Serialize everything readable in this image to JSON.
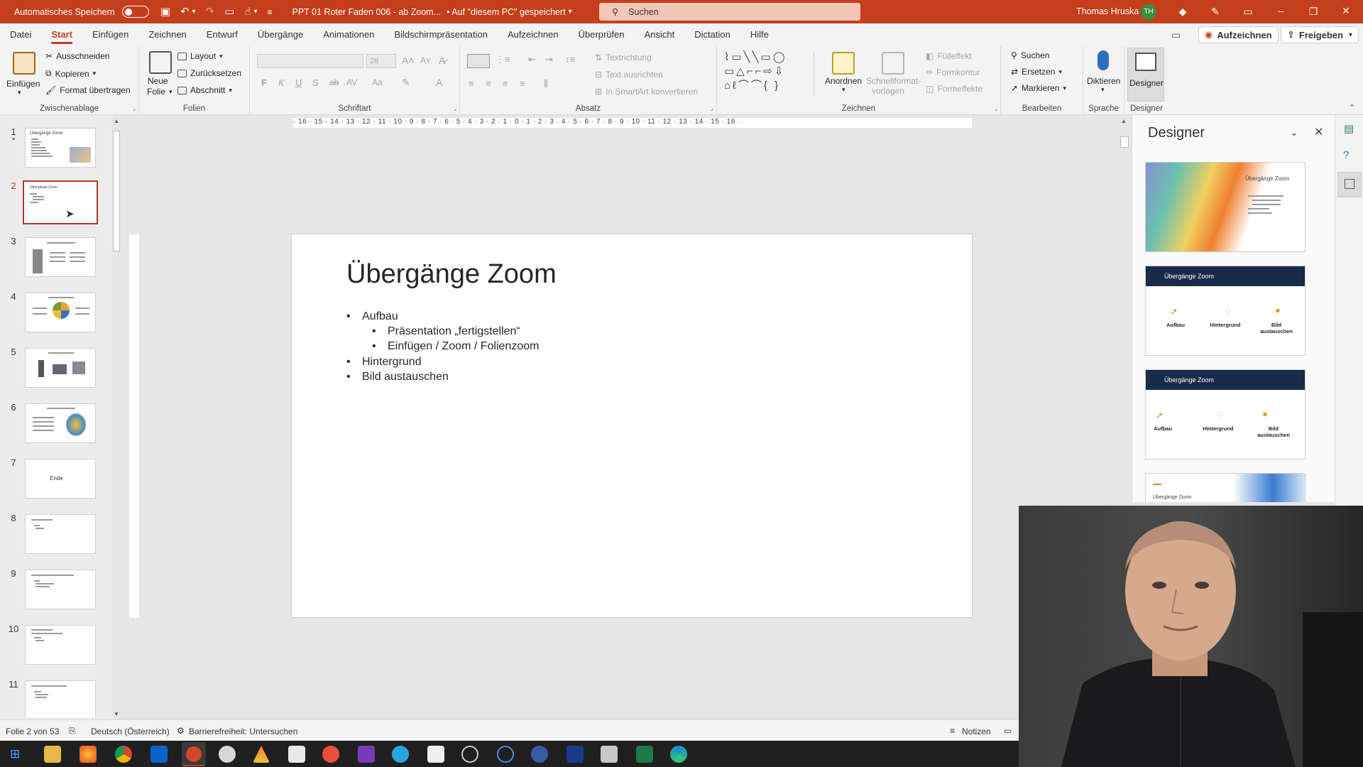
{
  "titlebar": {
    "autosave_label": "Automatisches Speichern",
    "doc_title": "PPT 01 Roter Faden 006 - ab Zoom...",
    "save_location": "• Auf \"diesem PC\" gespeichert",
    "search_placeholder": "Suchen",
    "user_name": "Thomas Hruska",
    "user_initials": "TH",
    "accent_color": "#c43e1c"
  },
  "menu": {
    "tabs": [
      "Datei",
      "Start",
      "Einfügen",
      "Zeichnen",
      "Entwurf",
      "Übergänge",
      "Animationen",
      "Bildschirmpräsentation",
      "Aufzeichnen",
      "Überprüfen",
      "Ansicht",
      "Dictation",
      "Hilfe"
    ],
    "active_tab": "Start",
    "record_button": "Aufzeichnen",
    "share_button": "Freigeben"
  },
  "ribbon": {
    "clipboard": {
      "label": "Zwischenablage",
      "paste": "Einfügen",
      "cut": "Ausschneiden",
      "copy": "Kopieren",
      "format_painter": "Format übertragen"
    },
    "slides": {
      "label": "Folien",
      "new_slide_1": "Neue",
      "new_slide_2": "Folie",
      "layout": "Layout",
      "reset": "Zurücksetzen",
      "section": "Abschnitt"
    },
    "font": {
      "label": "Schriftart",
      "size": "28",
      "bold": "F",
      "italic": "K",
      "underline": "U",
      "strike": "S",
      "spacing": "AV",
      "case": "Aa"
    },
    "paragraph": {
      "label": "Absatz",
      "text_direction": "Textrichtung",
      "align_text": "Text ausrichten",
      "smartart": "In SmartArt konvertieren"
    },
    "drawing": {
      "label": "Zeichnen",
      "arrange": "Anordnen",
      "quick_styles_1": "Schnellformat-",
      "quick_styles_2": "vorlagen",
      "fill": "Fülleffekt",
      "outline": "Formkontur",
      "effects": "Formeffekte"
    },
    "editing": {
      "label": "Bearbeiten",
      "find": "Suchen",
      "replace": "Ersetzen",
      "select": "Markieren"
    },
    "voice": {
      "label": "Sprache",
      "dictate": "Diktieren"
    },
    "designer_group": {
      "label": "Designer",
      "button": "Designer"
    }
  },
  "thumbnails": [
    {
      "num": "1",
      "title": "Übergänge Zoom"
    },
    {
      "num": "2",
      "title": "Übergänge Zoom"
    },
    {
      "num": "3",
      "title": ""
    },
    {
      "num": "4",
      "title": ""
    },
    {
      "num": "5",
      "title": ""
    },
    {
      "num": "6",
      "title": ""
    },
    {
      "num": "7",
      "title": "Ende"
    },
    {
      "num": "8",
      "title": ""
    },
    {
      "num": "9",
      "title": ""
    },
    {
      "num": "10",
      "title": ""
    },
    {
      "num": "11",
      "title": ""
    }
  ],
  "slide": {
    "title": "Übergänge Zoom",
    "bullets": [
      {
        "text": "Aufbau",
        "level": 1
      },
      {
        "text": "Präsentation „fertigstellen“",
        "level": 2
      },
      {
        "text": "Einfügen / Zoom / Folienzoom",
        "level": 2
      },
      {
        "text": "Hintergrund",
        "level": 1
      },
      {
        "text": "Bild austauschen",
        "level": 1
      }
    ]
  },
  "designer_pane": {
    "title": "Designer",
    "card_title": "Übergänge Zoom",
    "items": [
      "Aufbau",
      "Hintergrund",
      "Bild austauschen"
    ]
  },
  "statusbar": {
    "slide_pos": "Folie 2 von 53",
    "language": "Deutsch (Österreich)",
    "accessibility": "Barrierefreiheit: Untersuchen",
    "notes": "Notizen"
  },
  "ruler": {
    "h_ticks": "· 16 · 15 · 14 · 13 · 12 · 11 · 10 · 9 · 8 · 7 · 6 · 5 · 4 · 3 · 2 · 1 · 0 · 1 · 2 · 3 · 4 · 5 · 6 · 7 · 8 · 9 · 10 · 11 · 12 · 13 · 14 · 15 · 16 ·"
  }
}
